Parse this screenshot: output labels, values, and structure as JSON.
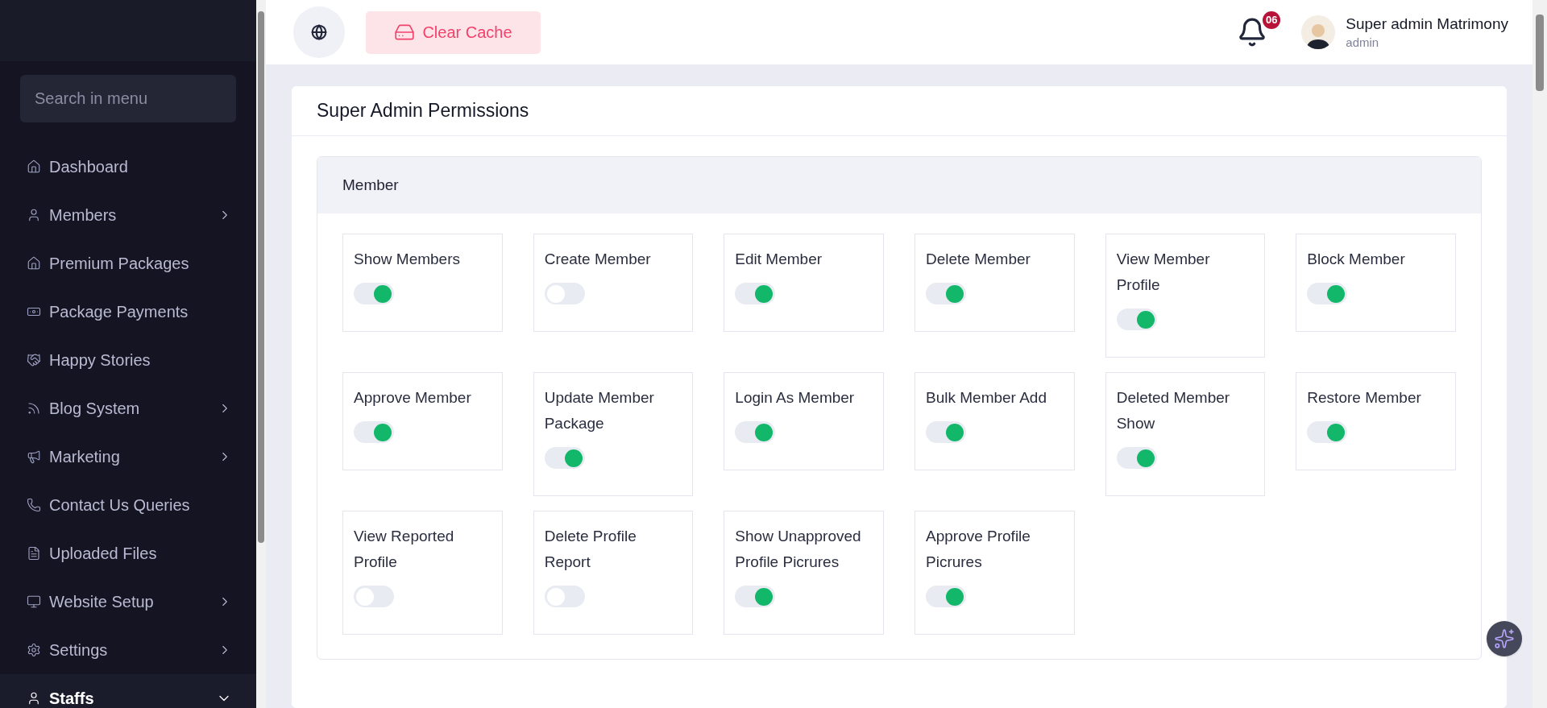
{
  "sidebar": {
    "search": {
      "placeholder": "Search in menu"
    },
    "items": [
      {
        "label": "Dashboard",
        "kind": "link",
        "selected": false
      },
      {
        "label": "Members",
        "kind": "submenu",
        "expanded": false,
        "selected": false
      },
      {
        "label": "Premium Packages",
        "kind": "link",
        "selected": false
      },
      {
        "label": "Package Payments",
        "kind": "link",
        "selected": false
      },
      {
        "label": "Happy Stories",
        "kind": "link",
        "selected": false
      },
      {
        "label": "Blog System",
        "kind": "submenu",
        "expanded": false,
        "selected": false
      },
      {
        "label": "Marketing",
        "kind": "submenu",
        "expanded": false,
        "selected": false
      },
      {
        "label": "Contact Us Queries",
        "kind": "link",
        "selected": false
      },
      {
        "label": "Uploaded Files",
        "kind": "link",
        "selected": false
      },
      {
        "label": "Website Setup",
        "kind": "submenu",
        "expanded": false,
        "selected": false
      },
      {
        "label": "Settings",
        "kind": "submenu",
        "expanded": false,
        "selected": false
      },
      {
        "label": "Staffs",
        "kind": "submenu",
        "expanded": true,
        "selected": true
      }
    ]
  },
  "header": {
    "clear_cache": "Clear Cache",
    "notification_count": "06",
    "user": {
      "name": "Super admin Matrimony",
      "role": "admin"
    }
  },
  "page": {
    "title": "Super Admin Permissions",
    "section": {
      "title": "Member",
      "permissions": [
        {
          "label": "Show Members",
          "on": true
        },
        {
          "label": "Create Member",
          "on": false
        },
        {
          "label": "Edit Member",
          "on": true
        },
        {
          "label": "Delete Member",
          "on": true
        },
        {
          "label": "View Member Profile",
          "on": true
        },
        {
          "label": "Block Member",
          "on": true
        },
        {
          "label": "Approve Member",
          "on": true
        },
        {
          "label": "Update Member Package",
          "on": true
        },
        {
          "label": "Login As Member",
          "on": true
        },
        {
          "label": "Bulk Member Add",
          "on": true
        },
        {
          "label": "Deleted Member Show",
          "on": true
        },
        {
          "label": "Restore Member",
          "on": true
        },
        {
          "label": "View Reported Profile",
          "on": false
        },
        {
          "label": "Delete Profile Report",
          "on": false
        },
        {
          "label": "Show Unapproved Profile Picrures",
          "on": true
        },
        {
          "label": "Approve Profile Picrures",
          "on": true
        }
      ]
    }
  }
}
